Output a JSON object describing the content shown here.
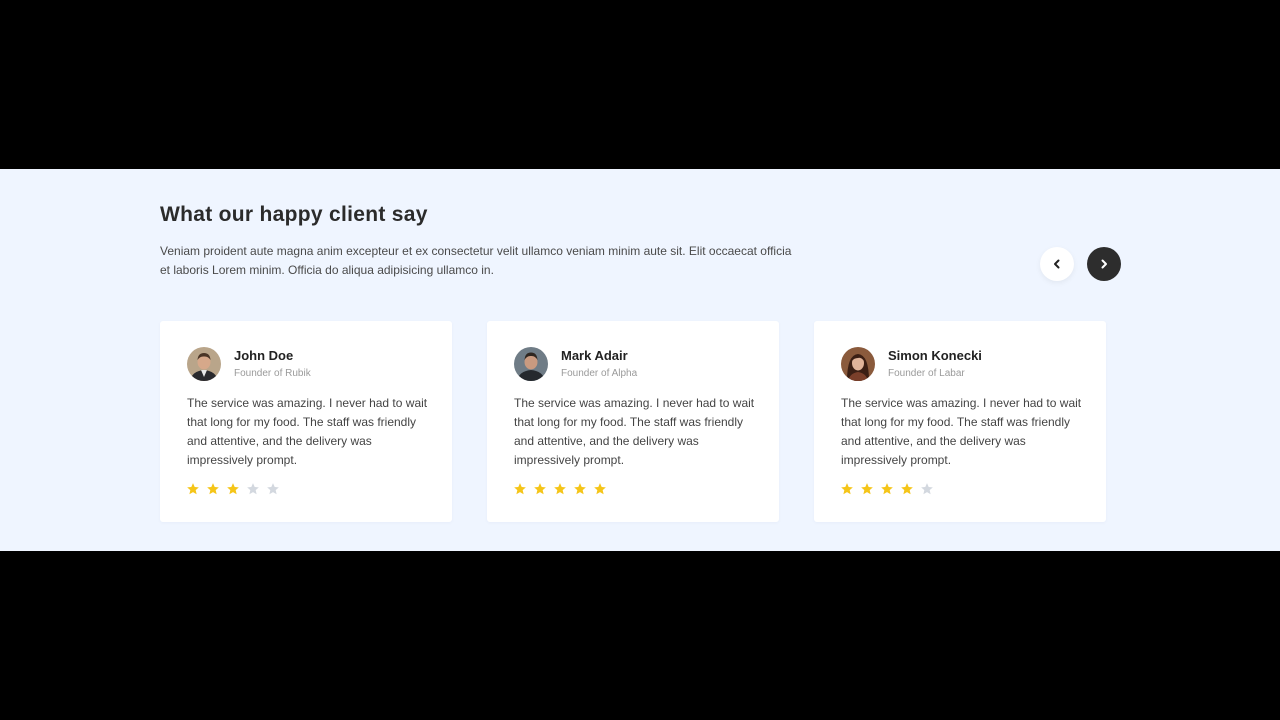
{
  "section": {
    "title": "What our happy client say",
    "intro": "Veniam proident aute magna anim excepteur et ex consectetur velit ullamco veniam minim aute sit. Elit occaecat officia et laboris Lorem minim. Officia do aliqua adipisicing ullamco in."
  },
  "nav": {
    "prev_icon": "chevron-left-icon",
    "next_icon": "chevron-right-icon"
  },
  "colors": {
    "section_bg": "#eff5ff",
    "star_filled": "#f5c518",
    "star_empty": "#d3d8df",
    "next_button": "#2d2d2d"
  },
  "testimonials": [
    {
      "name": "John Doe",
      "role": "Founder of Rubik",
      "quote": "The service was amazing. I never had to wait that long for my food. The staff was friendly and attentive, and the delivery was impressively prompt.",
      "rating": 3,
      "max_rating": 5
    },
    {
      "name": "Mark Adair",
      "role": "Founder of Alpha",
      "quote": "The service was amazing. I never had to wait that long for my food. The staff was friendly and attentive, and the delivery was impressively prompt.",
      "rating": 5,
      "max_rating": 5
    },
    {
      "name": "Simon Konecki",
      "role": "Founder of Labar",
      "quote": "The service was amazing. I never had to wait that long for my food. The staff was friendly and attentive, and the delivery was impressively prompt.",
      "rating": 4,
      "max_rating": 5
    }
  ]
}
